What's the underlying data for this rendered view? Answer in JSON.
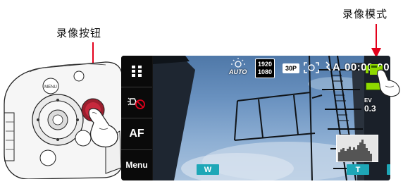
{
  "annotations": {
    "record_button_label": "录像按钮",
    "record_mode_label": "录像模式"
  },
  "sidebar": {
    "items": [
      {
        "icon": "thumbnail-grid-icon"
      },
      {
        "icon": "flash-off-icon"
      },
      {
        "label": "AF"
      },
      {
        "label": "Menu"
      }
    ]
  },
  "status_bar": {
    "scene_mode": "AUTO",
    "resolution_top": "1920",
    "resolution_bottom": "1080",
    "frame_rate": "30P",
    "face_detect_icon": "face-detect-icon",
    "anti_shake_icon": "anti-shake-icon",
    "anti_shake_label": "A",
    "timecode": "00:00:00",
    "mode_icon": "video-record-mode-icon"
  },
  "exposure": {
    "label": "EV",
    "value": "0.3"
  },
  "controls": {
    "zoom_wide": "W",
    "zoom_tele": "T",
    "playback_icon": "playback-icon"
  },
  "colors": {
    "accent": "#1ea7b7",
    "callout_arrow": "#e3001b",
    "mode_icon": "#8fd900",
    "battery": "#8fd900"
  }
}
